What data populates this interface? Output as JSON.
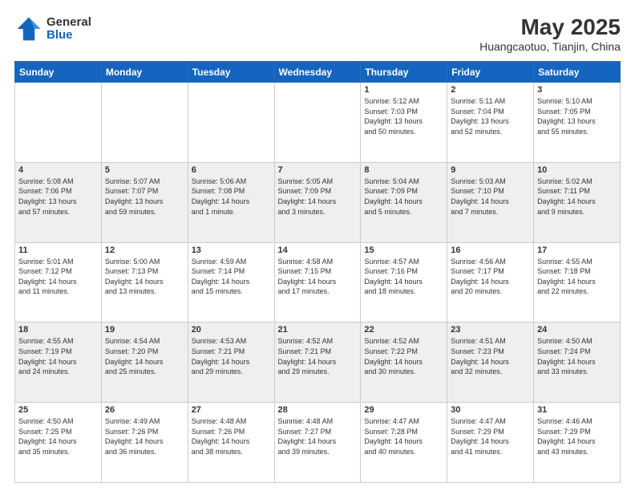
{
  "header": {
    "logo_general": "General",
    "logo_blue": "Blue",
    "month_year": "May 2025",
    "location": "Huangcaotuo, Tianjin, China"
  },
  "days_of_week": [
    "Sunday",
    "Monday",
    "Tuesday",
    "Wednesday",
    "Thursday",
    "Friday",
    "Saturday"
  ],
  "weeks": [
    [
      {
        "day": "",
        "info": ""
      },
      {
        "day": "",
        "info": ""
      },
      {
        "day": "",
        "info": ""
      },
      {
        "day": "",
        "info": ""
      },
      {
        "day": "1",
        "info": "Sunrise: 5:12 AM\nSunset: 7:03 PM\nDaylight: 13 hours\nand 50 minutes."
      },
      {
        "day": "2",
        "info": "Sunrise: 5:11 AM\nSunset: 7:04 PM\nDaylight: 13 hours\nand 52 minutes."
      },
      {
        "day": "3",
        "info": "Sunrise: 5:10 AM\nSunset: 7:05 PM\nDaylight: 13 hours\nand 55 minutes."
      }
    ],
    [
      {
        "day": "4",
        "info": "Sunrise: 5:08 AM\nSunset: 7:06 PM\nDaylight: 13 hours\nand 57 minutes."
      },
      {
        "day": "5",
        "info": "Sunrise: 5:07 AM\nSunset: 7:07 PM\nDaylight: 13 hours\nand 59 minutes."
      },
      {
        "day": "6",
        "info": "Sunrise: 5:06 AM\nSunset: 7:08 PM\nDaylight: 14 hours\nand 1 minute."
      },
      {
        "day": "7",
        "info": "Sunrise: 5:05 AM\nSunset: 7:09 PM\nDaylight: 14 hours\nand 3 minutes."
      },
      {
        "day": "8",
        "info": "Sunrise: 5:04 AM\nSunset: 7:09 PM\nDaylight: 14 hours\nand 5 minutes."
      },
      {
        "day": "9",
        "info": "Sunrise: 5:03 AM\nSunset: 7:10 PM\nDaylight: 14 hours\nand 7 minutes."
      },
      {
        "day": "10",
        "info": "Sunrise: 5:02 AM\nSunset: 7:11 PM\nDaylight: 14 hours\nand 9 minutes."
      }
    ],
    [
      {
        "day": "11",
        "info": "Sunrise: 5:01 AM\nSunset: 7:12 PM\nDaylight: 14 hours\nand 11 minutes."
      },
      {
        "day": "12",
        "info": "Sunrise: 5:00 AM\nSunset: 7:13 PM\nDaylight: 14 hours\nand 13 minutes."
      },
      {
        "day": "13",
        "info": "Sunrise: 4:59 AM\nSunset: 7:14 PM\nDaylight: 14 hours\nand 15 minutes."
      },
      {
        "day": "14",
        "info": "Sunrise: 4:58 AM\nSunset: 7:15 PM\nDaylight: 14 hours\nand 17 minutes."
      },
      {
        "day": "15",
        "info": "Sunrise: 4:57 AM\nSunset: 7:16 PM\nDaylight: 14 hours\nand 18 minutes."
      },
      {
        "day": "16",
        "info": "Sunrise: 4:56 AM\nSunset: 7:17 PM\nDaylight: 14 hours\nand 20 minutes."
      },
      {
        "day": "17",
        "info": "Sunrise: 4:55 AM\nSunset: 7:18 PM\nDaylight: 14 hours\nand 22 minutes."
      }
    ],
    [
      {
        "day": "18",
        "info": "Sunrise: 4:55 AM\nSunset: 7:19 PM\nDaylight: 14 hours\nand 24 minutes."
      },
      {
        "day": "19",
        "info": "Sunrise: 4:54 AM\nSunset: 7:20 PM\nDaylight: 14 hours\nand 25 minutes."
      },
      {
        "day": "20",
        "info": "Sunrise: 4:53 AM\nSunset: 7:21 PM\nDaylight: 14 hours\nand 29 minutes."
      },
      {
        "day": "21",
        "info": "Sunrise: 4:52 AM\nSunset: 7:21 PM\nDaylight: 14 hours\nand 29 minutes."
      },
      {
        "day": "22",
        "info": "Sunrise: 4:52 AM\nSunset: 7:22 PM\nDaylight: 14 hours\nand 30 minutes."
      },
      {
        "day": "23",
        "info": "Sunrise: 4:51 AM\nSunset: 7:23 PM\nDaylight: 14 hours\nand 32 minutes."
      },
      {
        "day": "24",
        "info": "Sunrise: 4:50 AM\nSunset: 7:24 PM\nDaylight: 14 hours\nand 33 minutes."
      }
    ],
    [
      {
        "day": "25",
        "info": "Sunrise: 4:50 AM\nSunset: 7:25 PM\nDaylight: 14 hours\nand 35 minutes."
      },
      {
        "day": "26",
        "info": "Sunrise: 4:49 AM\nSunset: 7:26 PM\nDaylight: 14 hours\nand 36 minutes."
      },
      {
        "day": "27",
        "info": "Sunrise: 4:48 AM\nSunset: 7:26 PM\nDaylight: 14 hours\nand 38 minutes."
      },
      {
        "day": "28",
        "info": "Sunrise: 4:48 AM\nSunset: 7:27 PM\nDaylight: 14 hours\nand 39 minutes."
      },
      {
        "day": "29",
        "info": "Sunrise: 4:47 AM\nSunset: 7:28 PM\nDaylight: 14 hours\nand 40 minutes."
      },
      {
        "day": "30",
        "info": "Sunrise: 4:47 AM\nSunset: 7:29 PM\nDaylight: 14 hours\nand 41 minutes."
      },
      {
        "day": "31",
        "info": "Sunrise: 4:46 AM\nSunset: 7:29 PM\nDaylight: 14 hours\nand 43 minutes."
      }
    ]
  ]
}
